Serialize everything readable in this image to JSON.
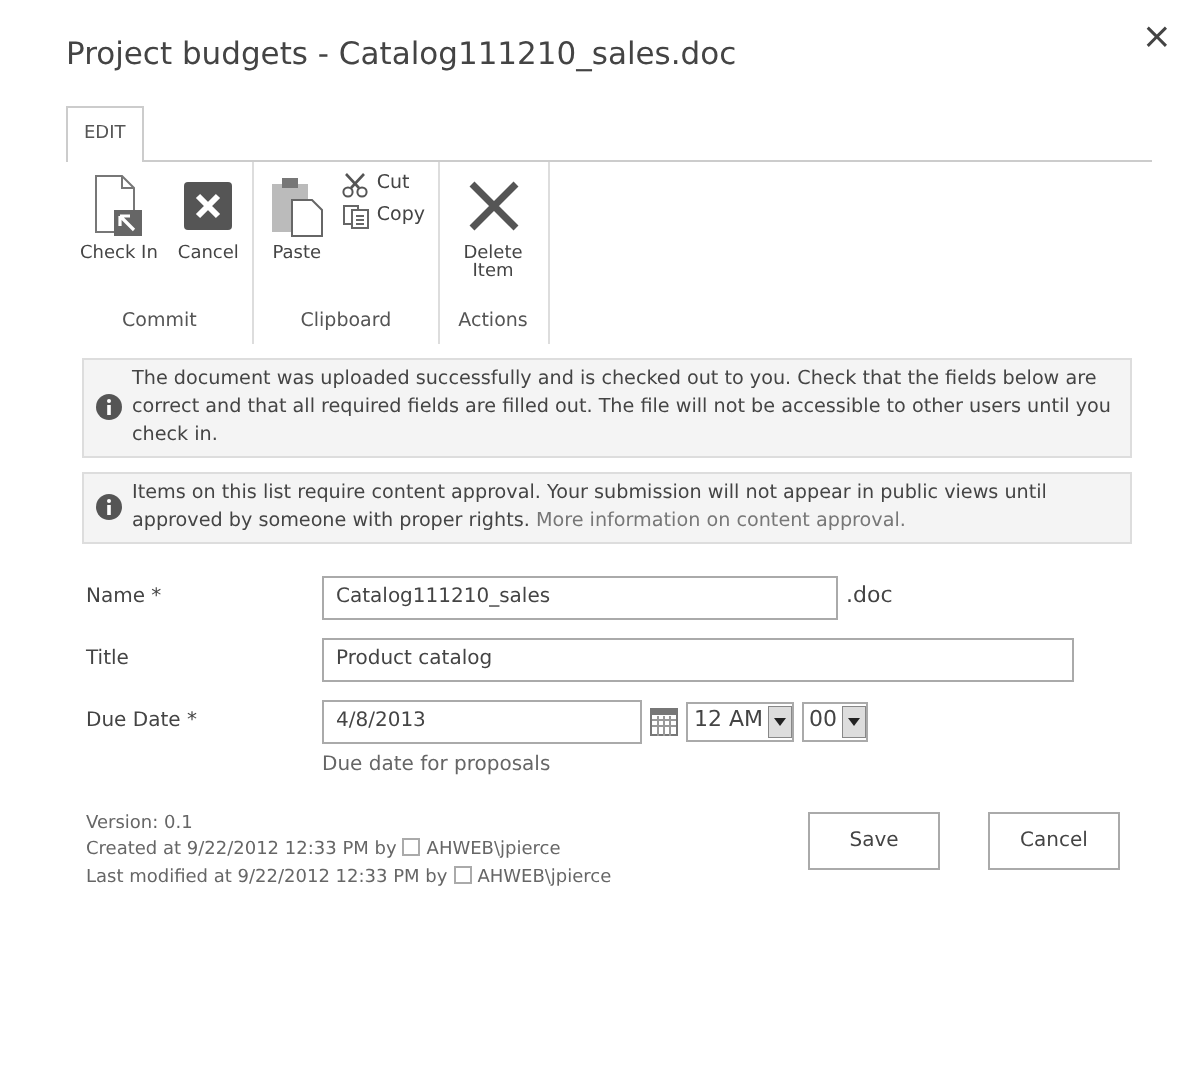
{
  "dialog": {
    "title": "Project budgets - Catalog111210_sales.doc",
    "close": "×"
  },
  "ribbon": {
    "tabs": [
      {
        "label": "EDIT",
        "selected": true
      }
    ],
    "groups": [
      {
        "label": "Commit",
        "items": [
          {
            "kind": "large",
            "label": "Check In"
          },
          {
            "kind": "large",
            "label": "Cancel"
          }
        ]
      },
      {
        "label": "Clipboard",
        "items": [
          {
            "kind": "large",
            "label": "Paste"
          },
          {
            "kind": "small",
            "label": "Cut"
          },
          {
            "kind": "small",
            "label": "Copy"
          }
        ]
      },
      {
        "label": "Actions",
        "items": [
          {
            "kind": "large",
            "label": "Delete Item"
          }
        ]
      }
    ]
  },
  "messages": [
    {
      "text": "The document was uploaded successfully and is checked out to you. Check that the fields below are correct and that all required fields are filled out. The file will not be accessible to other users until you check in."
    },
    {
      "text": "Items on this list require content approval. Your submission will not appear in public views until approved by someone with proper rights.",
      "link": "More information on content approval."
    }
  ],
  "fields": [
    {
      "kind": "text",
      "label": "Name *",
      "value": "Catalog111210_sales",
      "suffix": ".doc"
    },
    {
      "kind": "text",
      "label": "Title",
      "value": "Product catalog"
    },
    {
      "kind": "datetime",
      "label": "Due Date *",
      "value": "4/8/2013",
      "hour": "12 AM",
      "minute": "00",
      "hint": "Due date for proposals"
    }
  ],
  "footer": {
    "version": "Version: 0.1",
    "lines": [
      {
        "text": "Created at 9/22/2012 12:33 PM  by",
        "user": "AHWEB\\jpierce"
      },
      {
        "text": "Last modified at 9/22/2012 12:33 PM  by",
        "user": "AHWEB\\jpierce"
      }
    ],
    "buttons": [
      "Save",
      "Cancel"
    ]
  }
}
